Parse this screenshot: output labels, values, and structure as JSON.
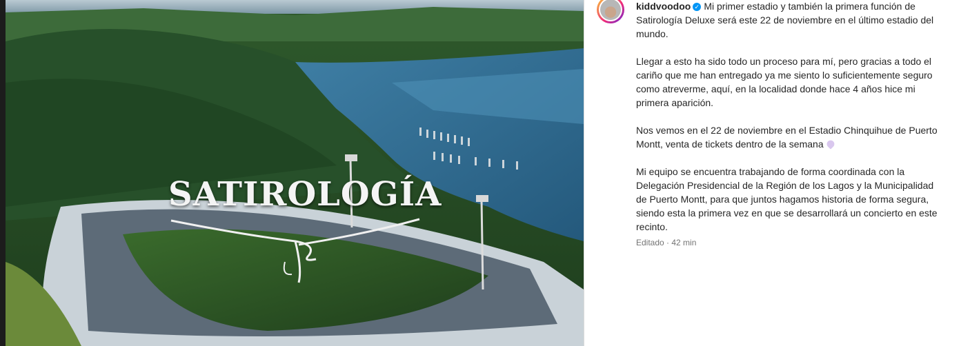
{
  "post": {
    "media": {
      "overlay_title": "SATIROLOGÍA"
    },
    "author": {
      "username": "kiddvoodoo",
      "verified_icon": "verified-badge-icon",
      "avatar": "avatar"
    },
    "caption": {
      "paragraph1": "Mi primer estadio y también la primera función de Satirología Deluxe será este 22 de noviembre en el último estadio del mundo.",
      "paragraph2": "Llegar a esto ha sido todo un proceso para mí, pero gracias a todo el cariño que me han entregado ya me siento lo suficientemente seguro como atreverme, aquí, en la localidad donde hace 4 años hice mi primera aparición.",
      "paragraph3": "Nos vemos en el 22 de noviembre en el Estadio Chinquihue de Puerto Montt, venta de tickets dentro de la semana",
      "paragraph3_emoji": "purple-heart-icon",
      "paragraph4": "Mi equipo se encuentra trabajando de forma coordinada con la Delegación Presidencial de la Región de los Lagos y la Municipalidad de Puerto Montt, para que juntos hagamos historia de forma segura, siendo esta la primera vez en que se desarrollará un concierto en este recinto."
    },
    "meta": {
      "edited": "Editado · 42 min"
    },
    "colors": {
      "verified": "#0095f6",
      "text": "#262626",
      "muted": "#737373"
    }
  }
}
